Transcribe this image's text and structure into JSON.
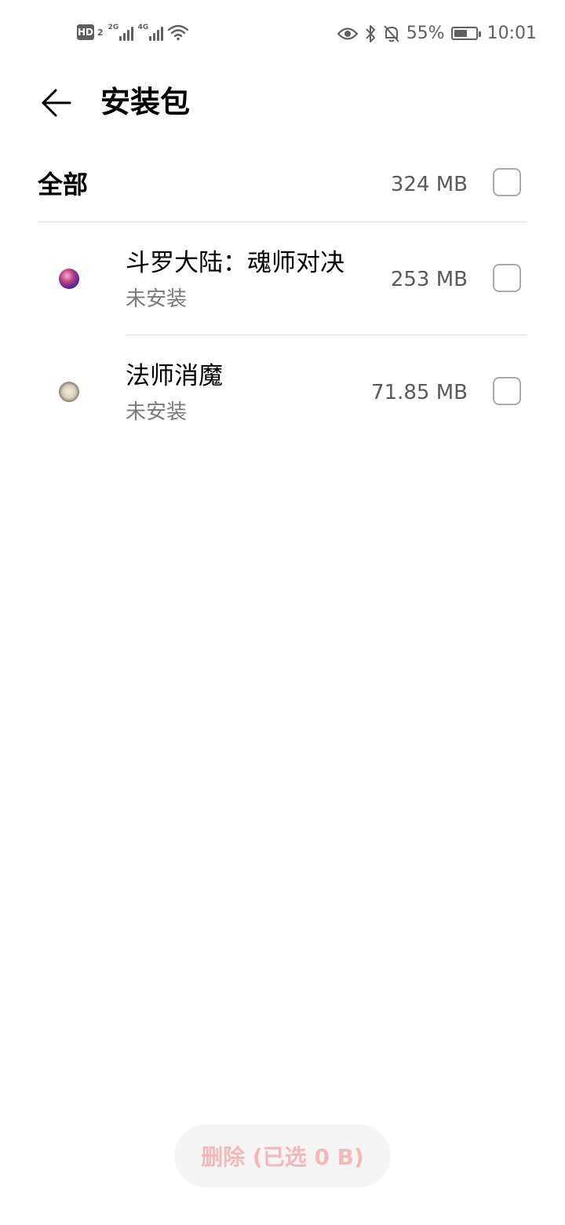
{
  "status_bar": {
    "hd_label": "HD",
    "sim_number": "2",
    "signal1_gen": "2G",
    "signal2_gen": "4G",
    "battery_percent": "55%",
    "time": "10:01"
  },
  "header": {
    "title": "安装包"
  },
  "all_row": {
    "label": "全部",
    "size": "324 MB"
  },
  "apps": [
    {
      "name": "斗罗大陆：魂师对决",
      "status": "未安装",
      "size": "253 MB",
      "icon": "douluo-app-icon"
    },
    {
      "name": "法师消魔",
      "status": "未安装",
      "size": "71.85 MB",
      "icon": "fashi-app-icon"
    }
  ],
  "footer": {
    "delete_label": "删除 (已选 0 B)"
  },
  "colors": {
    "delete_text": "#f3b8b8",
    "delete_bg": "#f5f5f5",
    "secondary_text": "#7a7a7a",
    "divider": "#e0e0e0"
  }
}
